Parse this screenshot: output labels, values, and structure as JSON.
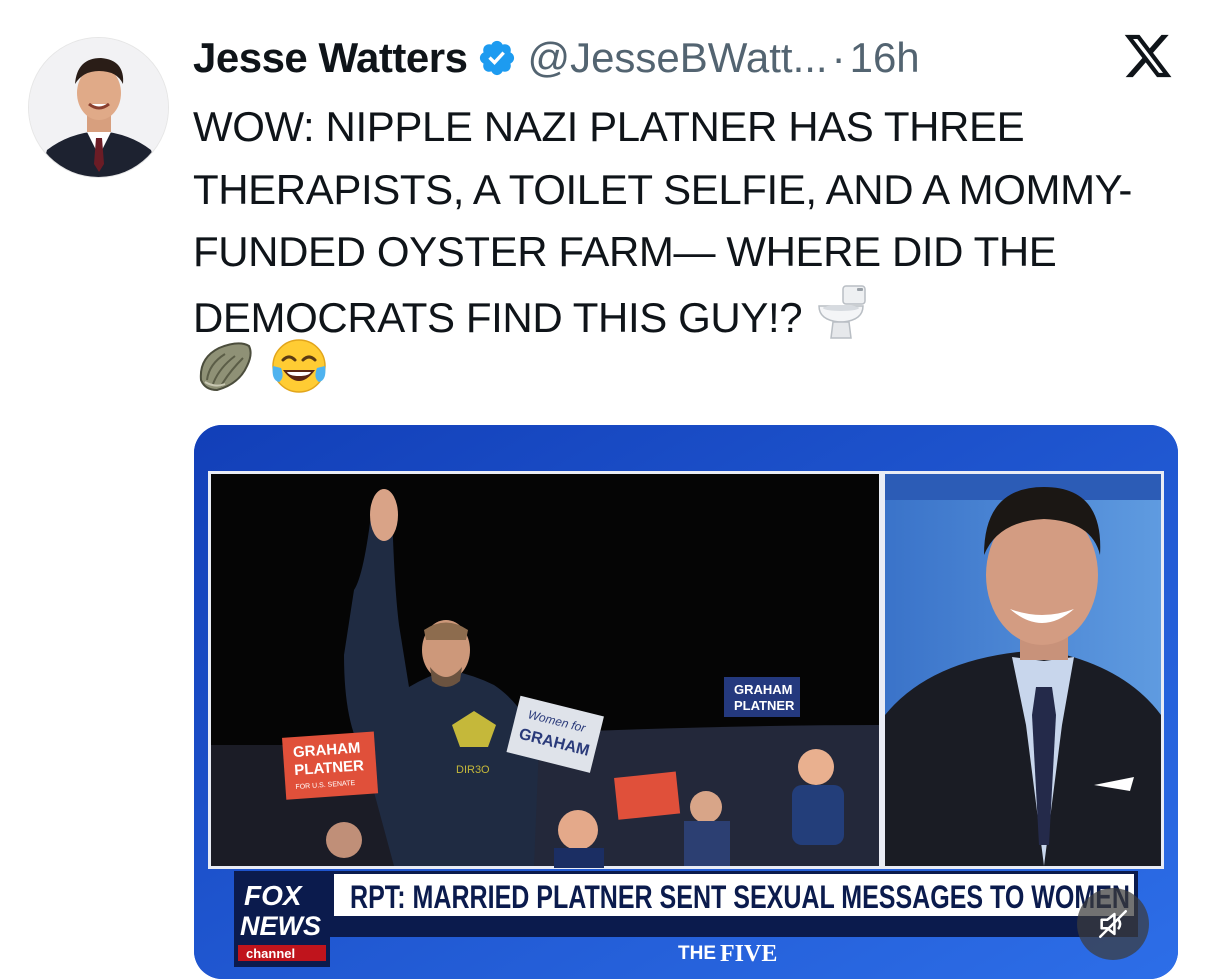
{
  "tweet": {
    "author_name": "Jesse Watters",
    "handle": "@JesseBWatt...",
    "separator": "·",
    "time": "16h",
    "text": "WOW: NIPPLE NAZI PLATNER HAS THREE THERAPISTS, A TOILET SELFIE, AND A MOMMY-FUNDED OYSTER FARM— WHERE DID THE DEMOCRATS FIND THIS GUY!?",
    "emojis": [
      "toilet-emoji",
      "oyster-emoji",
      "tears-of-joy-emoji"
    ]
  },
  "media": {
    "chyron_headline": "RPT: MARRIED PLATNER SENT SEXUAL MESSAGES TO WOMEN",
    "show_name_prefix": "THE",
    "show_name": "FIVE",
    "logo_line1": "FOX",
    "logo_line2": "NEWS",
    "logo_line3": "channel",
    "sign_left_line1": "GRAHAM",
    "sign_left_line2": "PLATNER",
    "sign_left_line3": "FOR U.S. SENATE",
    "sign_center_line1": "Women for",
    "sign_center_line2": "GRAHAM",
    "sign_right_line1": "GRAHAM",
    "sign_right_line2": "PLATNER",
    "shirt_text": "DIR3O"
  },
  "colors": {
    "verified_blue": "#1d9bf0",
    "secondary_text": "#536471",
    "fox_blue": "#1a4fd0",
    "chyron_navy": "#0b1b4d"
  }
}
